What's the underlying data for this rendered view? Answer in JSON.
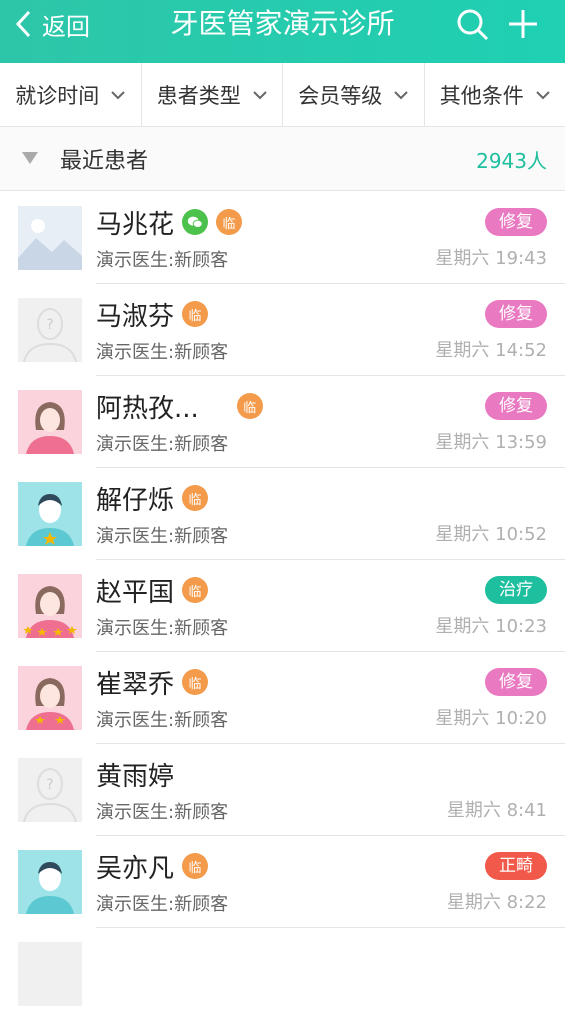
{
  "header": {
    "back_label": "返回",
    "title": "牙医管家演示诊所"
  },
  "filters": [
    {
      "label": "就诊时间"
    },
    {
      "label": "患者类型"
    },
    {
      "label": "会员等级"
    },
    {
      "label": "其他条件"
    }
  ],
  "section": {
    "label": "最近患者",
    "count": "2943人"
  },
  "badge_lin": "临",
  "colors": {
    "primary": "#1ebf9f",
    "tag_repair": "#e979c0",
    "tag_treat": "#1ebf9f",
    "tag_ortho": "#f15a4a",
    "badge_lin": "#f39b4a"
  },
  "patients": [
    {
      "name": "马兆花",
      "doctor": "演示医生:新顾客",
      "tag": "修复",
      "time": "星期六 19:43"
    },
    {
      "name": "马淑芬",
      "doctor": "演示医生:新顾客",
      "tag": "修复",
      "time": "星期六 14:52"
    },
    {
      "name": "阿热孜...",
      "doctor": "演示医生:新顾客",
      "tag": "修复",
      "time": "星期六 13:59"
    },
    {
      "name": "解仔烁",
      "doctor": "演示医生:新顾客",
      "tag": "",
      "time": "星期六 10:52"
    },
    {
      "name": "赵平国",
      "doctor": "演示医生:新顾客",
      "tag": "治疗",
      "time": "星期六 10:23"
    },
    {
      "name": "崔翠乔",
      "doctor": "演示医生:新顾客",
      "tag": "修复",
      "time": "星期六 10:20"
    },
    {
      "name": "黄雨婷",
      "doctor": "演示医生:新顾客",
      "tag": "",
      "time": "星期六 8:41"
    },
    {
      "name": "吴亦凡",
      "doctor": "演示医生:新顾客",
      "tag": "正畸",
      "time": "星期六 8:22"
    }
  ]
}
